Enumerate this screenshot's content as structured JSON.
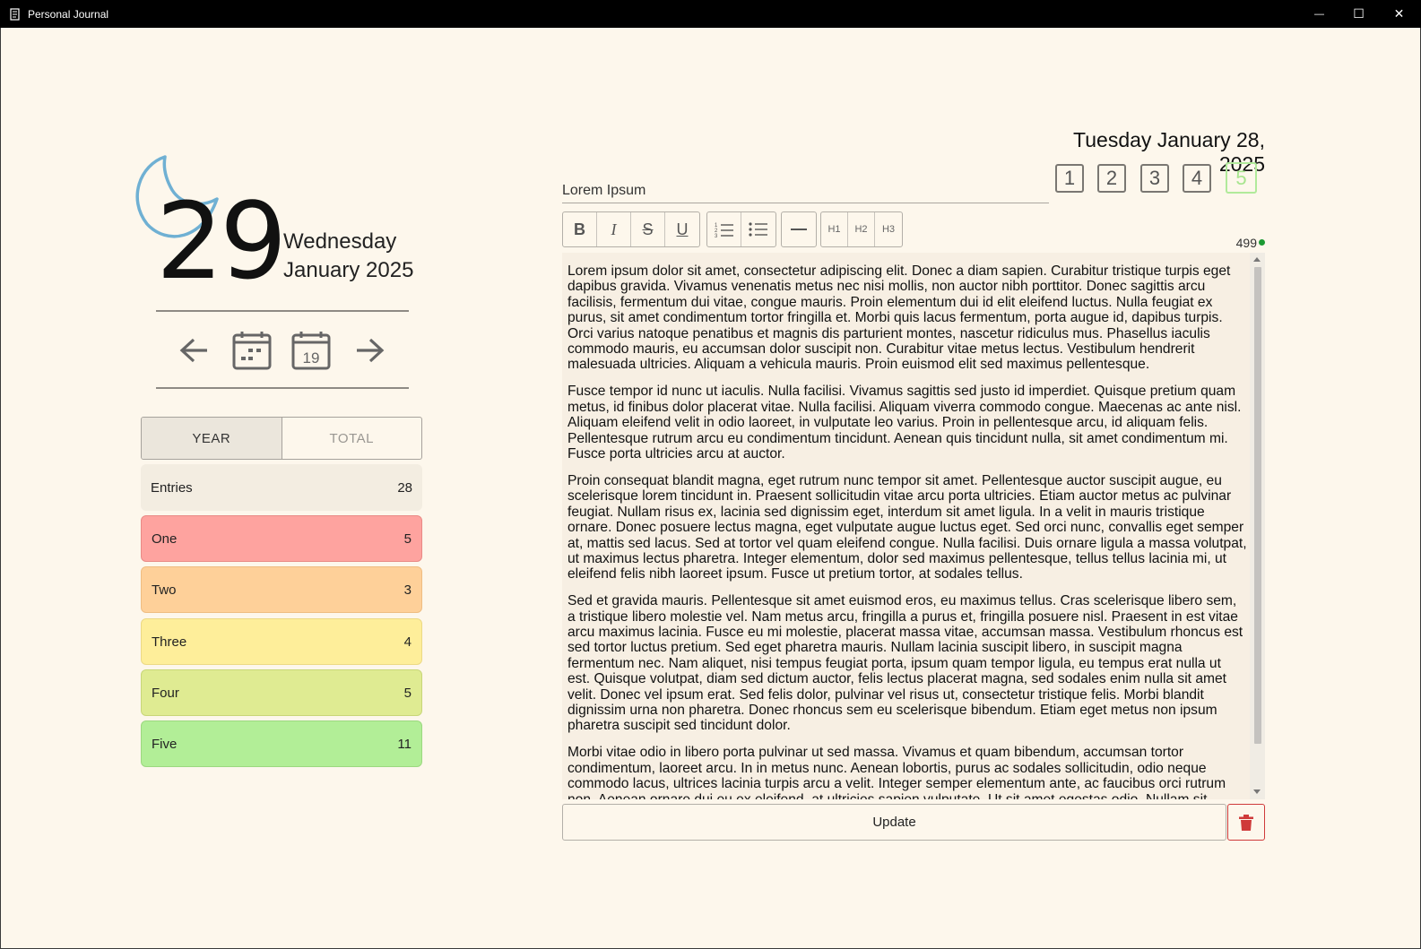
{
  "window": {
    "title": "Personal Journal",
    "minimize_glyph": "—",
    "maximize_glyph": "☐",
    "close_glyph": "✕"
  },
  "sidebar": {
    "day_number": "29",
    "weekday": "Wednesday",
    "month_year": "January 2025",
    "moon_icon": "crescent-moon-icon",
    "moon_color": "#6fb0d3",
    "nav": {
      "prev_icon": "arrow-left-icon",
      "calendar_icon": "calendar-icon",
      "today_icon": "calendar-today-icon",
      "today_day": "19",
      "next_icon": "arrow-right-icon"
    },
    "tabs": [
      {
        "label": "YEAR",
        "active": true
      },
      {
        "label": "TOTAL",
        "active": false
      }
    ],
    "stats": {
      "entries": {
        "label": "Entries",
        "value": "28"
      },
      "one": {
        "label": "One",
        "value": "5",
        "color": "#fea39f"
      },
      "two": {
        "label": "Two",
        "value": "3",
        "color": "#fed099"
      },
      "three": {
        "label": "Three",
        "value": "4",
        "color": "#feee9a"
      },
      "four": {
        "label": "Four",
        "value": "5",
        "color": "#dfeb92"
      },
      "five": {
        "label": "Five",
        "value": "11",
        "color": "#b2ee97"
      }
    }
  },
  "editor": {
    "current_date": "Tuesday January 28, 2025",
    "ratings": [
      "1",
      "2",
      "3",
      "4",
      "5"
    ],
    "selected_rating": "5",
    "selected_rating_color": "#a7e58e",
    "entry_title": "Lorem Ipsum",
    "toolbar": {
      "bold": "B",
      "italic": "I",
      "strike": "S",
      "underline": "U",
      "h1": "H1",
      "h2": "H2",
      "h3": "H3"
    },
    "char_count": "499",
    "status_color": "#1c9a33",
    "paragraphs": [
      "Lorem ipsum dolor sit amet, consectetur adipiscing elit. Donec a diam sapien. Curabitur tristique turpis eget dapibus gravida. Vivamus venenatis metus nec nisi mollis, non auctor nibh porttitor. Donec sagittis arcu facilisis, fermentum dui vitae, congue mauris. Proin elementum dui id elit eleifend luctus. Nulla feugiat ex purus, sit amet condimentum tortor fringilla et. Morbi quis lacus fermentum, porta augue id, dapibus turpis. Orci varius natoque penatibus et magnis dis parturient montes, nascetur ridiculus mus. Phasellus iaculis commodo mauris, eu accumsan dolor suscipit non. Curabitur vitae metus lectus. Vestibulum hendrerit malesuada ultricies. Aliquam a vehicula mauris. Proin euismod elit sed maximus pellentesque.",
      "Fusce tempor id nunc ut iaculis. Nulla facilisi. Vivamus sagittis sed justo id imperdiet. Quisque pretium quam metus, id finibus dolor placerat vitae. Nulla facilisi. Aliquam viverra commodo congue. Maecenas ac ante nisl. Aliquam eleifend velit in odio laoreet, in vulputate leo varius. Proin in pellentesque arcu, id aliquam felis. Pellentesque rutrum arcu eu condimentum tincidunt. Aenean quis tincidunt nulla, sit amet condimentum mi. Fusce porta ultricies arcu at auctor.",
      "Proin consequat blandit magna, eget rutrum nunc tempor sit amet. Pellentesque auctor suscipit augue, eu scelerisque lorem tincidunt in. Praesent sollicitudin vitae arcu porta ultricies. Etiam auctor metus ac pulvinar feugiat. Nullam risus ex, lacinia sed dignissim eget, interdum sit amet ligula. In a velit in mauris tristique ornare. Donec posuere lectus magna, eget vulputate augue luctus eget. Sed orci nunc, convallis eget semper at, mattis sed lacus. Sed at tortor vel quam eleifend congue. Nulla facilisi. Duis ornare ligula a massa volutpat, ut maximus lectus pharetra. Integer elementum, dolor sed maximus pellentesque, tellus tellus lacinia mi, ut eleifend felis nibh laoreet ipsum. Fusce ut pretium tortor, at sodales tellus.",
      "Sed et gravida mauris. Pellentesque sit amet euismod eros, eu maximus tellus. Cras scelerisque libero sem, a tristique libero molestie vel. Nam metus arcu, fringilla a purus et, fringilla posuere nisl. Praesent in est vitae arcu maximus lacinia. Fusce eu mi molestie, placerat massa vitae, accumsan massa. Vestibulum rhoncus est sed tortor luctus pretium. Sed eget pharetra mauris. Nullam lacinia suscipit libero, in suscipit magna fermentum nec. Nam aliquet, nisi tempus feugiat porta, ipsum quam tempor ligula, eu tempus erat nulla ut est. Quisque volutpat, diam sed dictum auctor, felis lectus placerat magna, sed sodales enim nulla sit amet velit. Donec vel ipsum erat. Sed felis dolor, pulvinar vel risus ut, consectetur tristique felis. Morbi blandit dignissim urna non pharetra. Donec rhoncus sem eu scelerisque bibendum. Etiam eget metus non ipsum pharetra suscipit sed tincidunt dolor.",
      "Morbi vitae odio in libero porta pulvinar ut sed massa. Vivamus et quam bibendum, accumsan tortor condimentum, laoreet arcu. In in metus nunc. Aenean lobortis, purus ac sodales sollicitudin, odio neque commodo lacus, ultrices lacinia turpis arcu a velit. Integer semper elementum ante, ac faucibus orci rutrum non. Aenean ornare dui eu ex eleifend, at ultricies sapien vulputate. Ut sit amet egestas odio. Nullam sit"
    ],
    "update_label": "Update",
    "delete_icon": "trash-icon",
    "delete_color": "#cf3a3a"
  }
}
